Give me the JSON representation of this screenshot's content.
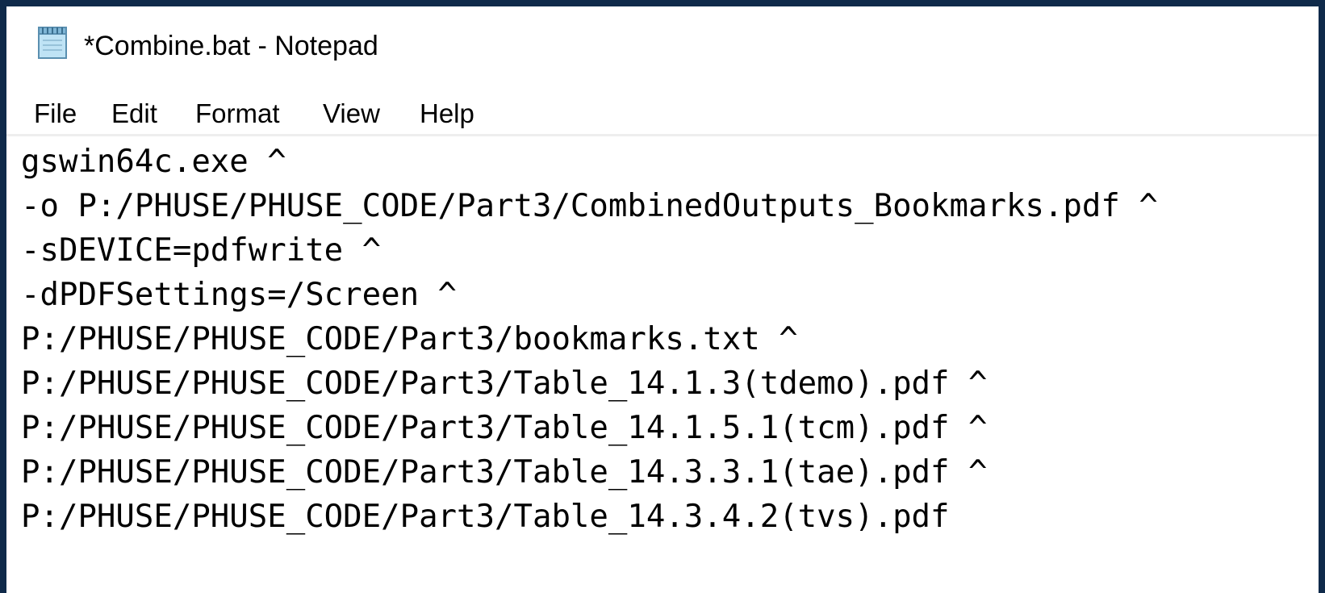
{
  "window": {
    "title": "*Combine.bat - Notepad",
    "icon": "notepad-icon"
  },
  "menu": [
    {
      "label": "File"
    },
    {
      "label": "Edit"
    },
    {
      "label": "Format"
    },
    {
      "label": "View"
    },
    {
      "label": "Help"
    }
  ],
  "editor": {
    "lines": [
      "gswin64c.exe ^",
      "-o P:/PHUSE/PHUSE_CODE/Part3/CombinedOutputs_Bookmarks.pdf ^",
      "-sDEVICE=pdfwrite ^",
      "-dPDFSettings=/Screen ^",
      "P:/PHUSE/PHUSE_CODE/Part3/bookmarks.txt ^",
      "P:/PHUSE/PHUSE_CODE/Part3/Table_14.1.3(tdemo).pdf ^",
      "P:/PHUSE/PHUSE_CODE/Part3/Table_14.1.5.1(tcm).pdf ^",
      "P:/PHUSE/PHUSE_CODE/Part3/Table_14.3.3.1(tae).pdf ^",
      "P:/PHUSE/PHUSE_CODE/Part3/Table_14.3.4.2(tvs).pdf"
    ]
  },
  "colors": {
    "desktop_background": "#0f2a4a",
    "window_background": "#ffffff",
    "text": "#000000"
  }
}
